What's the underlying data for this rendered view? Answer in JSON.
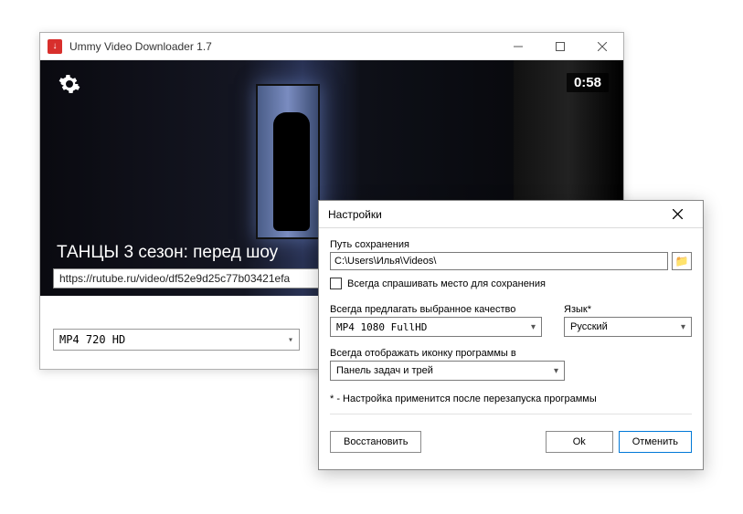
{
  "mainWindow": {
    "title": "Ummy Video Downloader 1.7",
    "video": {
      "duration": "0:58",
      "title": "ТАНЦЫ 3 сезон: перед шоу",
      "url": "https://rutube.ru/video/df52e9d25c77b03421efa"
    },
    "formatSelected": "MP4  720  HD"
  },
  "settings": {
    "title": "Настройки",
    "savePathLabel": "Путь сохранения",
    "savePathValue": "C:\\Users\\Илья\\Videos\\",
    "alwaysAskLabel": "Всегда спрашивать место для сохранения",
    "alwaysAskChecked": false,
    "qualityLabel": "Всегда предлагать выбранное качество",
    "qualityValue": "MP4  1080  FullHD",
    "langLabel": "Язык*",
    "langValue": "Русский",
    "trayLabel": "Всегда отображать иконку программы в",
    "trayValue": "Панель задач и трей",
    "note": "* - Настройка применится после перезапуска программы",
    "restoreBtn": "Восстановить",
    "okBtn": "Ok",
    "cancelBtn": "Отменить"
  }
}
